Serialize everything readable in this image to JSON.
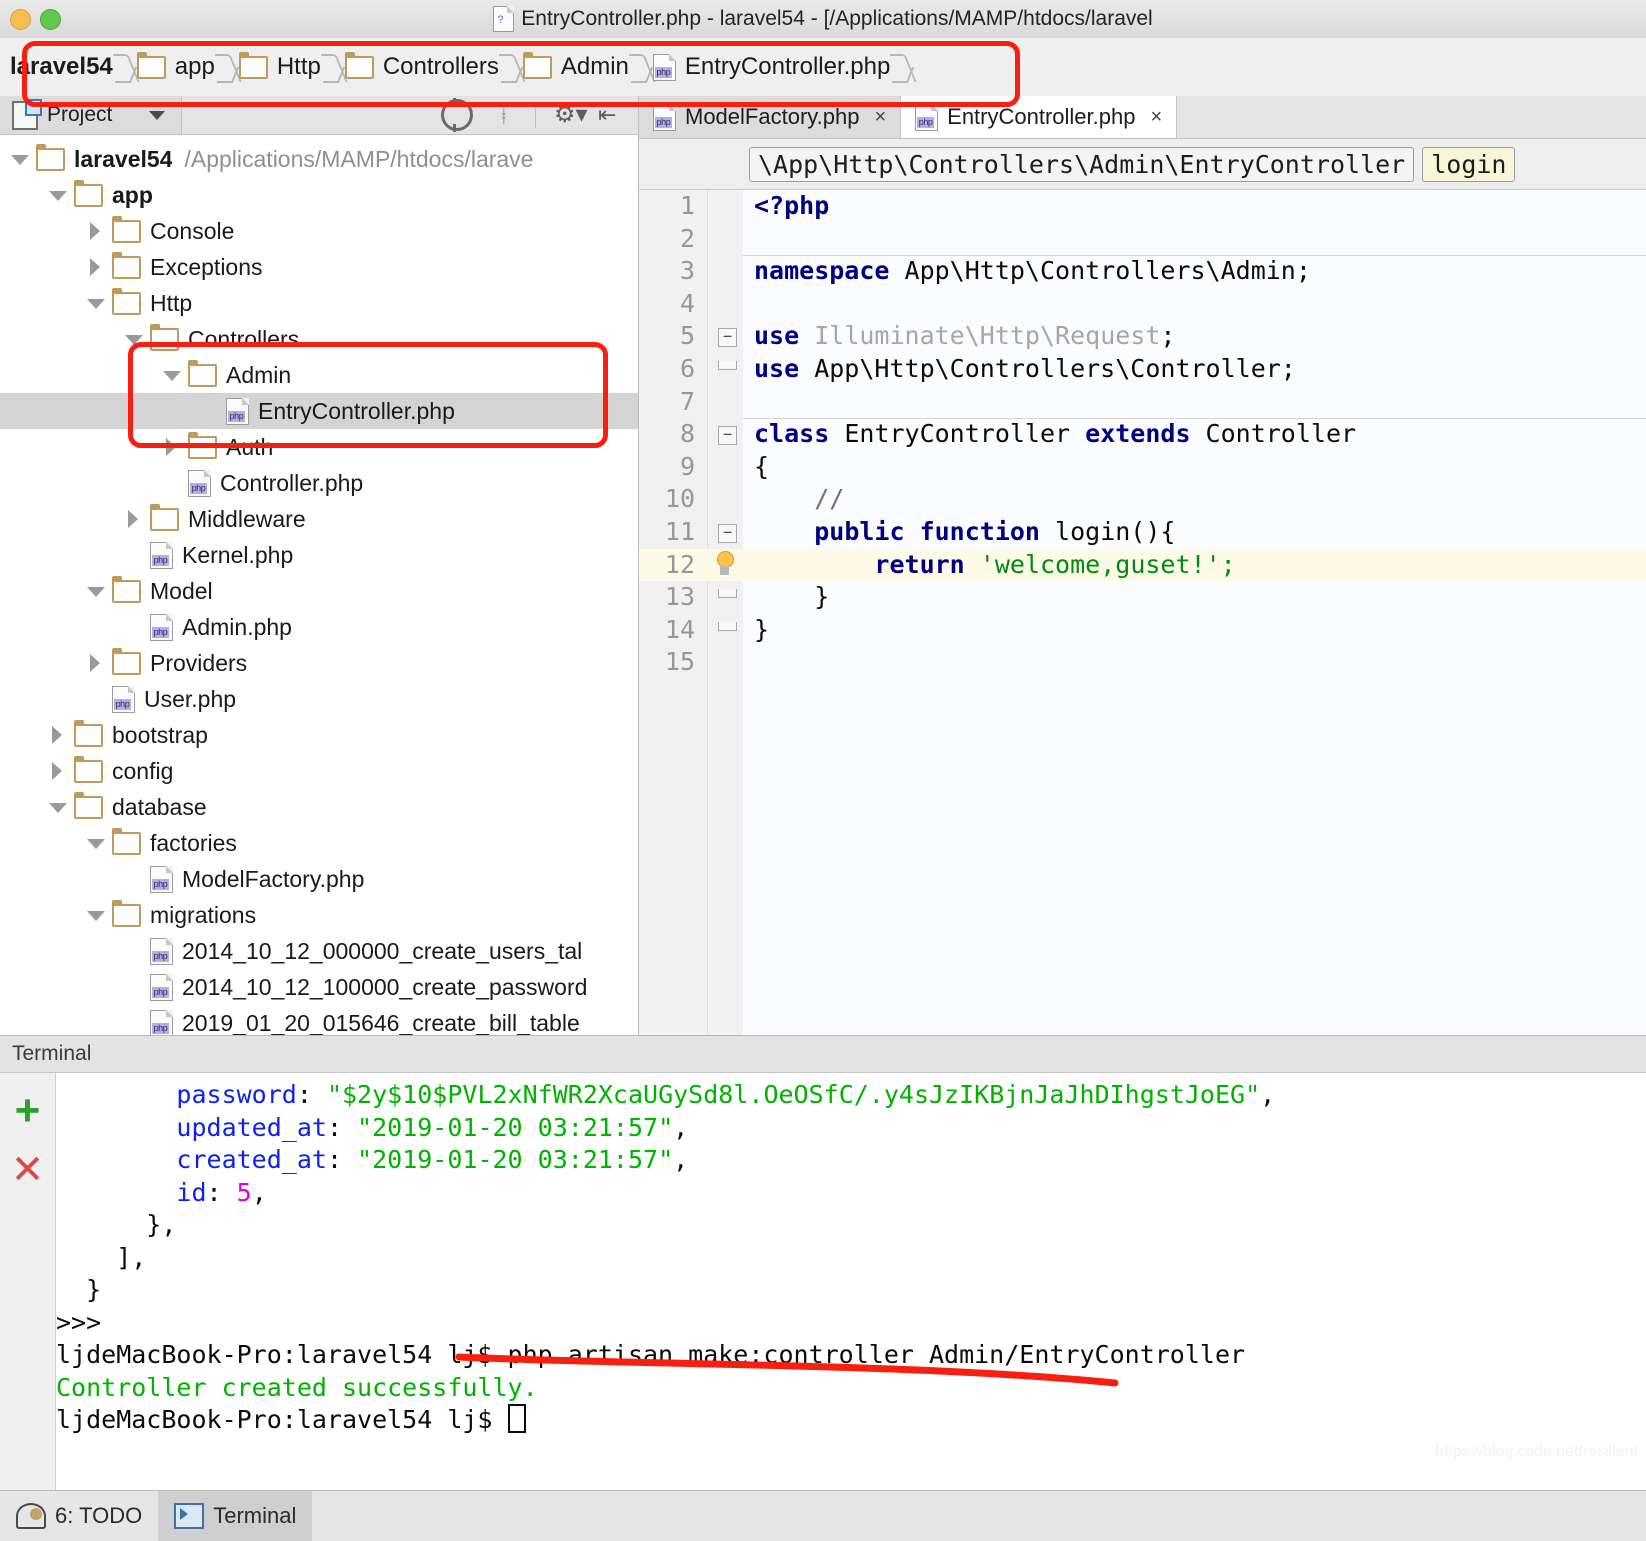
{
  "window": {
    "title": "EntryController.php - laravel54 - [/Applications/MAMP/htdocs/laravel",
    "file_icon": "php-file-icon"
  },
  "breadcrumb": {
    "items": [
      {
        "label": "laravel54",
        "icon": "none"
      },
      {
        "label": "app",
        "icon": "folder-icon"
      },
      {
        "label": "Http",
        "icon": "folder-icon"
      },
      {
        "label": "Controllers",
        "icon": "folder-icon"
      },
      {
        "label": "Admin",
        "icon": "folder-icon"
      },
      {
        "label": "EntryController.php",
        "icon": "php-file-icon"
      }
    ]
  },
  "project_panel": {
    "tab_label": "Project",
    "toolbar": [
      "locate-icon",
      "collapse-all-icon",
      "settings-gear-icon",
      "hide-panel-icon"
    ],
    "tree": [
      {
        "label": "laravel54",
        "suffix": "/Applications/MAMP/htdocs/larave",
        "icon": "folder-icon",
        "arrow": "down",
        "indent": 0,
        "bold": true,
        "selected": false
      },
      {
        "label": "app",
        "suffix": "",
        "icon": "folder-icon",
        "arrow": "down",
        "indent": 1,
        "bold": true,
        "selected": false
      },
      {
        "label": "Console",
        "suffix": "",
        "icon": "folder-icon",
        "arrow": "right",
        "indent": 2,
        "bold": false,
        "selected": false
      },
      {
        "label": "Exceptions",
        "suffix": "",
        "icon": "folder-icon",
        "arrow": "right",
        "indent": 2,
        "bold": false,
        "selected": false
      },
      {
        "label": "Http",
        "suffix": "",
        "icon": "folder-icon",
        "arrow": "down",
        "indent": 2,
        "bold": false,
        "selected": false
      },
      {
        "label": "Controllers",
        "suffix": "",
        "icon": "folder-icon",
        "arrow": "down",
        "indent": 3,
        "bold": false,
        "selected": false
      },
      {
        "label": "Admin",
        "suffix": "",
        "icon": "folder-icon",
        "arrow": "down",
        "indent": 4,
        "bold": false,
        "selected": false
      },
      {
        "label": "EntryController.php",
        "suffix": "",
        "icon": "php-file-icon",
        "arrow": "none",
        "indent": 5,
        "bold": false,
        "selected": true
      },
      {
        "label": "Auth",
        "suffix": "",
        "icon": "folder-icon",
        "arrow": "right",
        "indent": 4,
        "bold": false,
        "selected": false
      },
      {
        "label": "Controller.php",
        "suffix": "",
        "icon": "php-file-icon",
        "arrow": "none",
        "indent": 4,
        "bold": false,
        "selected": false
      },
      {
        "label": "Middleware",
        "suffix": "",
        "icon": "folder-icon",
        "arrow": "right",
        "indent": 3,
        "bold": false,
        "selected": false
      },
      {
        "label": "Kernel.php",
        "suffix": "",
        "icon": "php-file-icon",
        "arrow": "none",
        "indent": 3,
        "bold": false,
        "selected": false
      },
      {
        "label": "Model",
        "suffix": "",
        "icon": "folder-icon",
        "arrow": "down",
        "indent": 2,
        "bold": false,
        "selected": false
      },
      {
        "label": "Admin.php",
        "suffix": "",
        "icon": "php-file-icon",
        "arrow": "none",
        "indent": 3,
        "bold": false,
        "selected": false
      },
      {
        "label": "Providers",
        "suffix": "",
        "icon": "folder-icon",
        "arrow": "right",
        "indent": 2,
        "bold": false,
        "selected": false
      },
      {
        "label": "User.php",
        "suffix": "",
        "icon": "php-file-icon",
        "arrow": "none",
        "indent": 2,
        "bold": false,
        "selected": false
      },
      {
        "label": "bootstrap",
        "suffix": "",
        "icon": "folder-icon",
        "arrow": "right",
        "indent": 1,
        "bold": false,
        "selected": false
      },
      {
        "label": "config",
        "suffix": "",
        "icon": "folder-icon",
        "arrow": "right",
        "indent": 1,
        "bold": false,
        "selected": false
      },
      {
        "label": "database",
        "suffix": "",
        "icon": "folder-icon",
        "arrow": "down",
        "indent": 1,
        "bold": false,
        "selected": false
      },
      {
        "label": "factories",
        "suffix": "",
        "icon": "folder-icon",
        "arrow": "down",
        "indent": 2,
        "bold": false,
        "selected": false
      },
      {
        "label": "ModelFactory.php",
        "suffix": "",
        "icon": "php-file-icon",
        "arrow": "none",
        "indent": 3,
        "bold": false,
        "selected": false
      },
      {
        "label": "migrations",
        "suffix": "",
        "icon": "folder-icon",
        "arrow": "down",
        "indent": 2,
        "bold": false,
        "selected": false
      },
      {
        "label": "2014_10_12_000000_create_users_tal",
        "suffix": "",
        "icon": "php-file-icon",
        "arrow": "none",
        "indent": 3,
        "bold": false,
        "selected": false
      },
      {
        "label": "2014_10_12_100000_create_password",
        "suffix": "",
        "icon": "php-file-icon",
        "arrow": "none",
        "indent": 3,
        "bold": false,
        "selected": false
      },
      {
        "label": "2019_01_20_015646_create_bill_table",
        "suffix": "",
        "icon": "php-file-icon",
        "arrow": "none",
        "indent": 3,
        "bold": false,
        "selected": false
      }
    ]
  },
  "editor": {
    "tabs": [
      {
        "label": "ModelFactory.php",
        "active": false,
        "close": "×"
      },
      {
        "label": "EntryController.php",
        "active": true,
        "close": "×"
      }
    ],
    "structure_crumbs": [
      {
        "label": "\\App\\Http\\Controllers\\Admin\\EntryController",
        "highlight": false
      },
      {
        "label": "login",
        "highlight": true
      }
    ],
    "lines": [
      {
        "n": "1",
        "segments": [
          {
            "t": "<?php",
            "c": "kw"
          }
        ],
        "fold": "",
        "current": false,
        "bulb": false,
        "rule_above": false
      },
      {
        "n": "2",
        "segments": [],
        "fold": "",
        "current": false,
        "bulb": false,
        "rule_above": false
      },
      {
        "n": "3",
        "segments": [
          {
            "t": "namespace",
            "c": "kw"
          },
          {
            "t": " App\\Http\\Controllers\\Admin;",
            "c": ""
          }
        ],
        "fold": "",
        "current": false,
        "bulb": false,
        "rule_above": true
      },
      {
        "n": "4",
        "segments": [],
        "fold": "",
        "current": false,
        "bulb": false,
        "rule_above": false
      },
      {
        "n": "5",
        "segments": [
          {
            "t": "use",
            "c": "kw"
          },
          {
            "t": " ",
            "c": ""
          },
          {
            "t": "Illuminate\\Http\\Request",
            "c": "dim"
          },
          {
            "t": ";",
            "c": ""
          }
        ],
        "fold": "start",
        "current": false,
        "bulb": false,
        "rule_above": false
      },
      {
        "n": "6",
        "segments": [
          {
            "t": "use",
            "c": "kw"
          },
          {
            "t": " App\\Http\\Controllers\\Controller;",
            "c": ""
          }
        ],
        "fold": "end",
        "current": false,
        "bulb": false,
        "rule_above": false
      },
      {
        "n": "7",
        "segments": [],
        "fold": "",
        "current": false,
        "bulb": false,
        "rule_above": false
      },
      {
        "n": "8",
        "segments": [
          {
            "t": "class",
            "c": "kw"
          },
          {
            "t": " EntryController ",
            "c": ""
          },
          {
            "t": "extends",
            "c": "kw"
          },
          {
            "t": " Controller",
            "c": ""
          }
        ],
        "fold": "start",
        "current": false,
        "bulb": false,
        "rule_above": true
      },
      {
        "n": "9",
        "segments": [
          {
            "t": "{",
            "c": ""
          }
        ],
        "fold": "",
        "current": false,
        "bulb": false,
        "rule_above": false
      },
      {
        "n": "10",
        "segments": [
          {
            "t": "    //",
            "c": "cmt"
          }
        ],
        "fold": "",
        "current": false,
        "bulb": false,
        "rule_above": false
      },
      {
        "n": "11",
        "segments": [
          {
            "t": "    ",
            "c": ""
          },
          {
            "t": "public function",
            "c": "kw"
          },
          {
            "t": " login(){",
            "c": ""
          }
        ],
        "fold": "start",
        "current": false,
        "bulb": false,
        "rule_above": false
      },
      {
        "n": "12",
        "segments": [
          {
            "t": "        ",
            "c": ""
          },
          {
            "t": "return",
            "c": "kw"
          },
          {
            "t": " ",
            "c": ""
          },
          {
            "t": "'welcome,",
            "c": "str"
          },
          {
            "t": "guset",
            "c": "str typo"
          },
          {
            "t": "!';",
            "c": "str"
          }
        ],
        "fold": "",
        "current": true,
        "bulb": true,
        "rule_above": false
      },
      {
        "n": "13",
        "segments": [
          {
            "t": "    }",
            "c": ""
          }
        ],
        "fold": "end",
        "current": false,
        "bulb": false,
        "rule_above": false
      },
      {
        "n": "14",
        "segments": [
          {
            "t": "}",
            "c": ""
          }
        ],
        "fold": "end",
        "current": false,
        "bulb": false,
        "rule_above": false
      },
      {
        "n": "15",
        "segments": [],
        "fold": "",
        "current": false,
        "bulb": false,
        "rule_above": false
      }
    ]
  },
  "terminal": {
    "title": "Terminal",
    "side_buttons": [
      "add-tab-icon",
      "close-tab-icon"
    ],
    "output": [
      {
        "segments": [
          {
            "t": "        ",
            "c": ""
          },
          {
            "t": "password",
            "c": "tblue"
          },
          {
            "t": ": ",
            "c": ""
          },
          {
            "t": "\"$2y$10$PVL2xNfWR2XcaUGySd8l.OeOSfC/.y4sJzIKBjnJaJhDIhgstJoEG\"",
            "c": "tgreen"
          },
          {
            "t": ",",
            "c": ""
          }
        ]
      },
      {
        "segments": [
          {
            "t": "        ",
            "c": ""
          },
          {
            "t": "updated_at",
            "c": "tblue"
          },
          {
            "t": ": ",
            "c": ""
          },
          {
            "t": "\"2019-01-20 03:21:57\"",
            "c": "tgreen"
          },
          {
            "t": ",",
            "c": ""
          }
        ]
      },
      {
        "segments": [
          {
            "t": "        ",
            "c": ""
          },
          {
            "t": "created_at",
            "c": "tblue"
          },
          {
            "t": ": ",
            "c": ""
          },
          {
            "t": "\"2019-01-20 03:21:57\"",
            "c": "tgreen"
          },
          {
            "t": ",",
            "c": ""
          }
        ]
      },
      {
        "segments": [
          {
            "t": "        ",
            "c": ""
          },
          {
            "t": "id",
            "c": "tblue"
          },
          {
            "t": ": ",
            "c": ""
          },
          {
            "t": "5",
            "c": "tmag"
          },
          {
            "t": ",",
            "c": ""
          }
        ]
      },
      {
        "segments": [
          {
            "t": "      },",
            "c": ""
          }
        ]
      },
      {
        "segments": [
          {
            "t": "    ],",
            "c": ""
          }
        ]
      },
      {
        "segments": [
          {
            "t": "  }",
            "c": ""
          }
        ]
      },
      {
        "segments": [
          {
            "t": ">>>",
            "c": ""
          }
        ]
      },
      {
        "segments": [
          {
            "t": "ljdeMacBook-Pro:laravel54 lj$ php artisan make:controller Admin/EntryController",
            "c": ""
          }
        ]
      },
      {
        "segments": [
          {
            "t": "Controller created successfully.",
            "c": "tgreen"
          }
        ]
      },
      {
        "segments": [
          {
            "t": "ljdeMacBook-Pro:laravel54 lj$ ",
            "c": ""
          }
        ],
        "cursor": true
      }
    ]
  },
  "statusbar": {
    "items": [
      {
        "label": "6: TODO",
        "icon": "todo-icon",
        "selected": false
      },
      {
        "label": "Terminal",
        "icon": "terminal-icon",
        "selected": true
      }
    ]
  },
  "watermark": "https://blog.csdn.net/resilient",
  "colors": {
    "annotation": "#f91f10",
    "keyword": "#000080",
    "string": "#028a0f",
    "terminal_blue": "#1020f0",
    "terminal_green": "#00b300",
    "terminal_magenta": "#e000e0",
    "folder": "#c09a5a"
  }
}
